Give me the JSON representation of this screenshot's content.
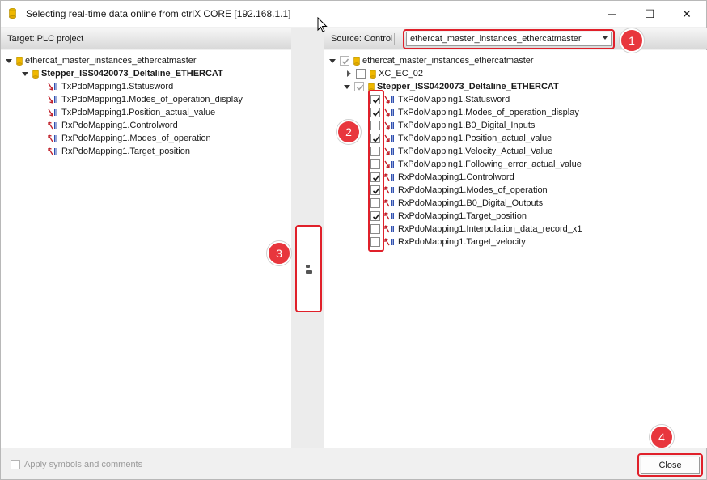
{
  "window": {
    "title": "Selecting real-time data online from ctrlX CORE [192.168.1.1]",
    "minimize_glyph": "─",
    "maximize_glyph": "☐",
    "close_glyph": "✕"
  },
  "target": {
    "header": "Target: PLC project",
    "tree": [
      {
        "label": "ethercat_master_instances_ethercatmaster",
        "bold": false,
        "icon": "cylinder-icon"
      },
      {
        "label": "Stepper_ISS0420073_Deltaline_ETHERCAT",
        "bold": true,
        "icon": "cylinder-icon"
      },
      {
        "label": "TxPdoMapping1.Statusword",
        "icon": "input-signal-icon"
      },
      {
        "label": "TxPdoMapping1.Modes_of_operation_display",
        "icon": "input-signal-icon"
      },
      {
        "label": "TxPdoMapping1.Position_actual_value",
        "icon": "input-signal-icon"
      },
      {
        "label": "RxPdoMapping1.Controlword",
        "icon": "output-signal-icon"
      },
      {
        "label": "RxPdoMapping1.Modes_of_operation",
        "icon": "output-signal-icon"
      },
      {
        "label": "RxPdoMapping1.Target_position",
        "icon": "output-signal-icon"
      }
    ]
  },
  "source": {
    "header": "Source: Control",
    "dropdown_value": "ethercat_master_instances_ethercatmaster",
    "tree": [
      {
        "label": "ethercat_master_instances_ethercatmaster",
        "checked": true,
        "bold": false
      },
      {
        "label": "XC_EC_02",
        "checked": false,
        "bold": false
      },
      {
        "label": "Stepper_ISS0420073_Deltaline_ETHERCAT",
        "checked": true,
        "bold": true
      },
      {
        "label": "TxPdoMapping1.Statusword",
        "checked": true
      },
      {
        "label": "TxPdoMapping1.Modes_of_operation_display",
        "checked": true
      },
      {
        "label": "TxPdoMapping1.B0_Digital_Inputs",
        "checked": false
      },
      {
        "label": "TxPdoMapping1.Position_actual_value",
        "checked": true
      },
      {
        "label": "TxPdoMapping1.Velocity_Actual_Value",
        "checked": false
      },
      {
        "label": "TxPdoMapping1.Following_error_actual_value",
        "checked": false
      },
      {
        "label": "RxPdoMapping1.Controlword",
        "checked": true
      },
      {
        "label": "RxPdoMapping1.Modes_of_operation",
        "checked": true
      },
      {
        "label": "RxPdoMapping1.B0_Digital_Outputs",
        "checked": false
      },
      {
        "label": "RxPdoMapping1.Target_position",
        "checked": true
      },
      {
        "label": "RxPdoMapping1.Interpolation_data_record_x1",
        "checked": false
      },
      {
        "label": "RxPdoMapping1.Target_velocity",
        "checked": false
      }
    ]
  },
  "annotations": [
    "1",
    "2",
    "3",
    "4"
  ],
  "footer": {
    "apply_label": "Apply symbols and comments",
    "close_label": "Close"
  },
  "colors": {
    "highlight": "#e0202a",
    "badge": "#e8363d",
    "cylinder": "#e8b400"
  }
}
